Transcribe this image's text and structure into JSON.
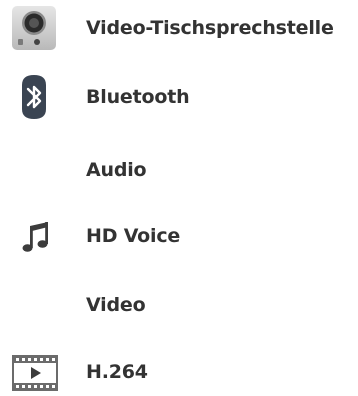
{
  "features": {
    "items": [
      {
        "label": "Video-Tischsprechstelle",
        "icon": "desk-videophone-icon"
      },
      {
        "label": "Bluetooth",
        "icon": "bluetooth-icon"
      },
      {
        "label": "Audio",
        "icon": ""
      },
      {
        "label": "HD Voice",
        "icon": "music-note-icon"
      },
      {
        "label": "Video",
        "icon": ""
      },
      {
        "label": "H.264",
        "icon": "video-film-icon"
      }
    ]
  }
}
